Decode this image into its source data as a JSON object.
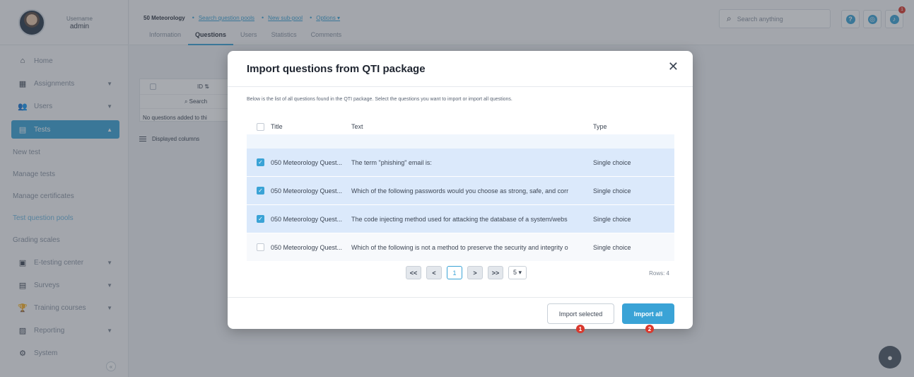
{
  "user": {
    "role_label": "Username",
    "name": "admin"
  },
  "sidebar": {
    "items": [
      {
        "label": "Home",
        "icon": "home-icon",
        "glyph": "⌂"
      },
      {
        "label": "Assignments",
        "icon": "assignments-icon",
        "glyph": "▦"
      },
      {
        "label": "Users",
        "icon": "users-icon",
        "glyph": "👥"
      },
      {
        "label": "Tests",
        "icon": "tests-icon",
        "glyph": "▤"
      },
      {
        "label": "E-testing center",
        "icon": "calendar-icon",
        "glyph": "▣"
      },
      {
        "label": "Surveys",
        "icon": "surveys-icon",
        "glyph": "▤"
      },
      {
        "label": "Training courses",
        "icon": "trophy-icon",
        "glyph": "🏆"
      },
      {
        "label": "Reporting",
        "icon": "reporting-icon",
        "glyph": "▨"
      },
      {
        "label": "System",
        "icon": "gear-icon",
        "glyph": "⚙"
      }
    ],
    "subitems": [
      "New test",
      "Manage tests",
      "Manage certificates",
      "Test question pools",
      "Grading scales"
    ]
  },
  "breadcrumb": {
    "first": "50 Meteorology",
    "links": [
      "Search question pools",
      "New sub-pool",
      "Options ▾"
    ]
  },
  "tabs": [
    "Information",
    "Questions",
    "Users",
    "Statistics",
    "Comments"
  ],
  "search": {
    "placeholder": "Search anything"
  },
  "background_table": {
    "id_header": "ID ⇅",
    "search_label": "Search",
    "empty_text": "No questions added to thi",
    "displayed_columns": "Displayed columns"
  },
  "modal": {
    "title": "Import questions from QTI package",
    "description": "Below is the list of all questions found in the QTI package. Select the questions you want to import or import all questions.",
    "headers": {
      "title": "Title",
      "text": "Text",
      "type": "Type"
    },
    "rows": [
      {
        "title": "050 Meteorology Quest...",
        "text": "The term \"phishing\" email is:",
        "type": "Single choice",
        "checked": true
      },
      {
        "title": "050 Meteorology Quest...",
        "text": "Which of the following passwords would you choose as strong, safe, and corr",
        "type": "Single choice",
        "checked": true
      },
      {
        "title": "050 Meteorology Quest...",
        "text": "The code injecting method used for attacking the database of a system/webs",
        "type": "Single choice",
        "checked": true
      },
      {
        "title": "050 Meteorology Quest...",
        "text": "Which of the following is not a method to preserve the security and integrity o",
        "type": "Single choice",
        "checked": false
      }
    ],
    "pagination": {
      "first": "<<",
      "prev": "<",
      "current": "1",
      "next": ">",
      "last": ">>",
      "page_size": "5 ▾"
    },
    "rows_count": "Rows: 4",
    "import_selected": "Import selected",
    "import_all": "Import all",
    "markers": [
      "1",
      "2"
    ]
  },
  "colors": {
    "accent": "#3aa3d6",
    "marker": "#d9382d",
    "row_selected": "#dbe9fb"
  }
}
